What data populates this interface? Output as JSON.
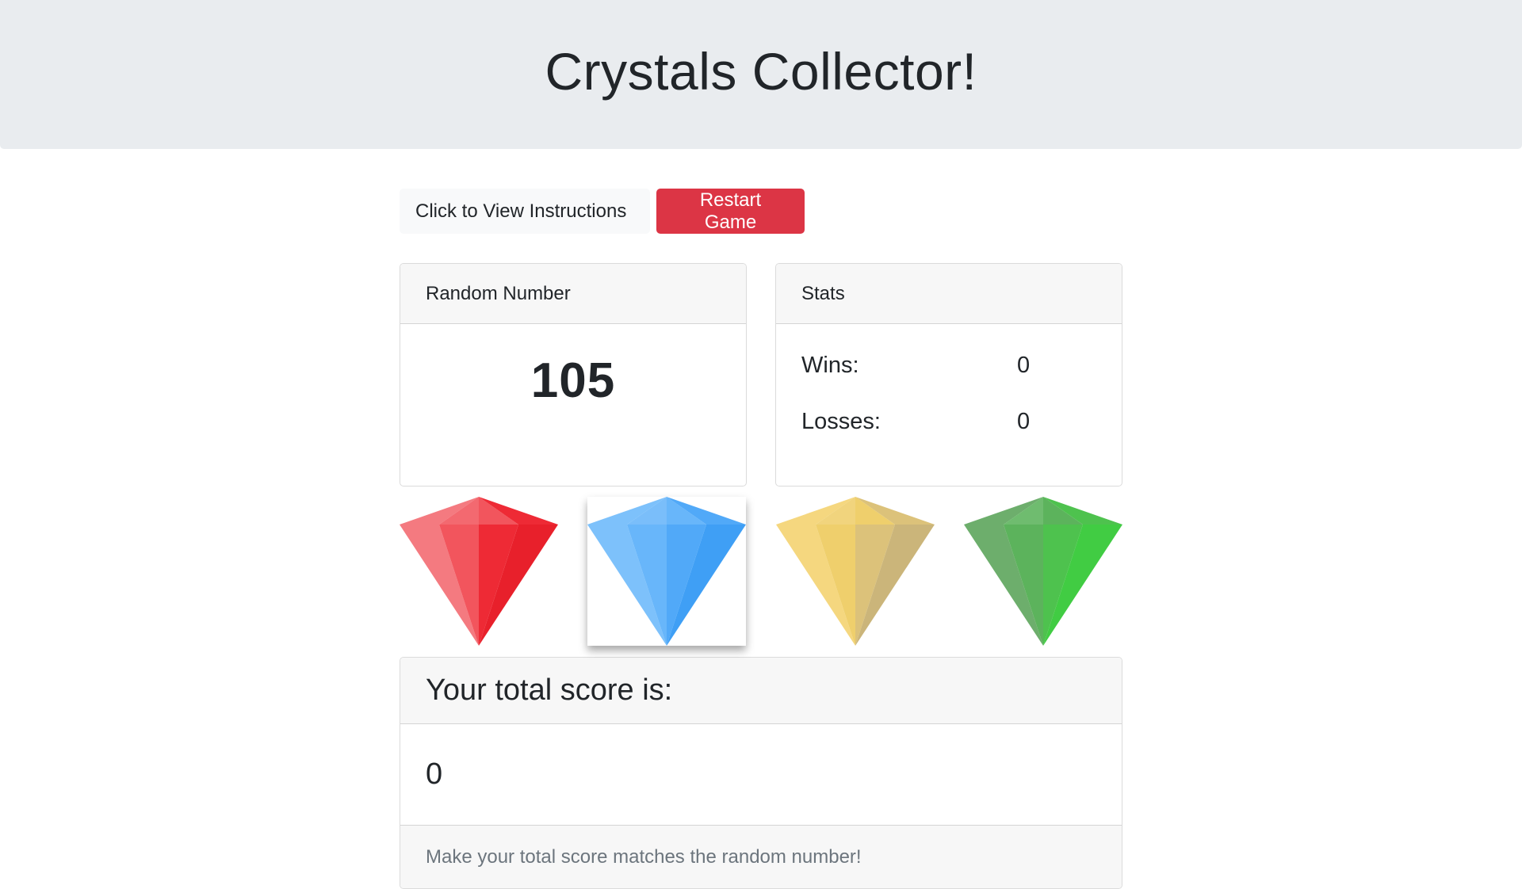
{
  "header": {
    "title": "Crystals Collector!"
  },
  "buttons": {
    "instructions_label": "Click to View Instructions",
    "restart_label": "Restart Game"
  },
  "random_card": {
    "header": "Random Number",
    "value": "105"
  },
  "stats_card": {
    "header": "Stats",
    "wins_label": "Wins:",
    "wins_value": "0",
    "losses_label": "Losses:",
    "losses_value": "0"
  },
  "crystals": [
    {
      "name": "red-crystal-icon",
      "colors": {
        "light": "#f47a80",
        "mid": "#f2555d",
        "dark": "#ee2a35",
        "deep": "#e8202b"
      }
    },
    {
      "name": "blue-crystal-icon",
      "colors": {
        "light": "#7dc1fb",
        "mid": "#68b6fa",
        "dark": "#51a9f8",
        "deep": "#3f9ff5"
      }
    },
    {
      "name": "yellow-crystal-icon",
      "colors": {
        "light": "#f5d77f",
        "mid": "#efcf6c",
        "dark": "#dcc27a",
        "deep": "#cbb57a"
      }
    },
    {
      "name": "green-crystal-icon",
      "colors": {
        "light": "#6dae6c",
        "mid": "#5cb35c",
        "dark": "#4ec24e",
        "deep": "#41cc43"
      }
    }
  ],
  "score_card": {
    "header": "Your total score is:",
    "value": "0",
    "footer": "Make your total score matches the random number!"
  }
}
